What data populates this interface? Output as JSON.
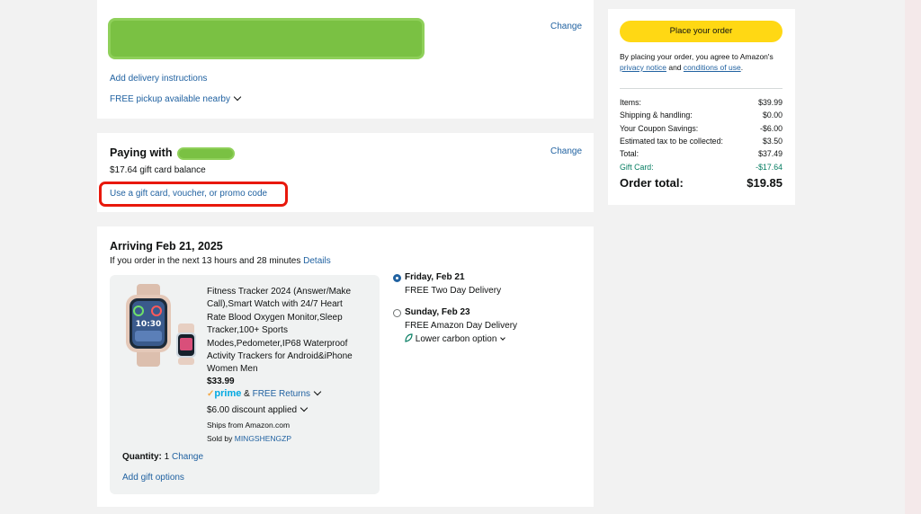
{
  "address": {
    "change_label": "Change",
    "delivery_instructions": "Add delivery instructions",
    "pickup": "FREE pickup available nearby"
  },
  "payment": {
    "heading": "Paying with",
    "change_label": "Change",
    "balance": "$17.64 gift card balance",
    "promo_link": "Use a gift card, voucher, or promo code"
  },
  "arriving": {
    "heading": "Arriving Feb 21, 2025",
    "countdown": "If you order in the next 13 hours and 28 minutes",
    "details_link": "Details",
    "product": {
      "title_lines": [
        "Fitness Tracker 2024 (Answer/Make",
        "Call),Smart Watch with 24/7 Heart",
        "Rate Blood Oxygen Monitor,Sleep",
        "Tracker,100+ Sports",
        "Modes,Pedometer,IP68 Waterproof",
        "Activity Trackers for Android&iPhone",
        "Women Men"
      ],
      "price": "$33.99",
      "prime_label": "prime",
      "amp": "&",
      "free_returns": "FREE Returns",
      "discount": "$6.00 discount applied",
      "ships_from": "Ships from Amazon.com",
      "sold_by_label": "Sold by",
      "seller": "MINGSHENGZP",
      "quantity_label": "Quantity:",
      "quantity_value": "1",
      "quantity_change": "Change",
      "gift_options": "Add gift options",
      "watch_time": "10:30"
    },
    "options": [
      {
        "day": "Friday, Feb 21",
        "desc": "FREE Two Day Delivery",
        "selected": true
      },
      {
        "day": "Sunday, Feb 23",
        "desc": "FREE Amazon Day Delivery",
        "selected": false,
        "extra": "Lower carbon option"
      }
    ]
  },
  "summary": {
    "place_order": "Place your order",
    "agree_line1": "By placing your order, you agree to Amazon's",
    "privacy": "privacy notice",
    "and": "and",
    "conditions": "conditions of use",
    "period": ".",
    "rows": [
      {
        "label": "Items:",
        "value": "$39.99"
      },
      {
        "label": "Shipping & handling:",
        "value": "$0.00"
      },
      {
        "label": "Your Coupon Savings:",
        "value": "-$6.00"
      },
      {
        "label": "Estimated tax to be collected:",
        "value": "$3.50"
      },
      {
        "label": "Total:",
        "value": "$37.49"
      },
      {
        "label": "Gift Card:",
        "value": "-$17.64"
      }
    ],
    "order_total_label": "Order total:",
    "order_total_value": "$19.85"
  },
  "colors": {
    "link": "#2162a1",
    "button_yellow": "#ffd814",
    "highlight_red": "#e8180c",
    "redaction_green": "#7ac143",
    "gift_card_green": "#067d62",
    "prime_blue": "#00a8e1",
    "prime_check_orange": "#f3a847"
  },
  "icons": [
    "chevron-down-icon",
    "leaf-icon",
    "prime-check-icon",
    "radio-selected-icon",
    "radio-unselected-icon"
  ]
}
